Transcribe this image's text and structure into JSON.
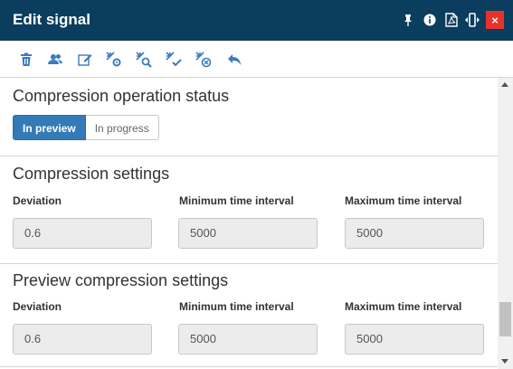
{
  "window": {
    "title": "Edit signal",
    "title_icons": [
      "pin-icon",
      "info-icon",
      "pdf-icon",
      "resize-icon"
    ],
    "close_label": "×",
    "accent_color": "#0b3d5e",
    "close_color": "#e8312a"
  },
  "toolbar": {
    "tools": [
      "trash-icon",
      "users-icon",
      "edit-icon",
      "compress-settings-icon",
      "compress-search-icon",
      "compress-check-icon",
      "compress-clear-icon",
      "undo-icon"
    ],
    "icon_color": "#3a7bbf"
  },
  "status": {
    "title": "Compression operation status",
    "options": [
      "In preview",
      "In progress"
    ],
    "selected": "In preview"
  },
  "compression": {
    "title": "Compression settings",
    "deviation_label": "Deviation",
    "min_label": "Minimum time interval",
    "max_label": "Maximum time interval",
    "deviation_value": "0.6",
    "min_value": "5000",
    "max_value": "5000"
  },
  "preview": {
    "title": "Preview compression settings",
    "deviation_label": "Deviation",
    "min_label": "Minimum time interval",
    "max_label": "Maximum time interval",
    "deviation_value": "0.6",
    "min_value": "5000",
    "max_value": "5000"
  }
}
